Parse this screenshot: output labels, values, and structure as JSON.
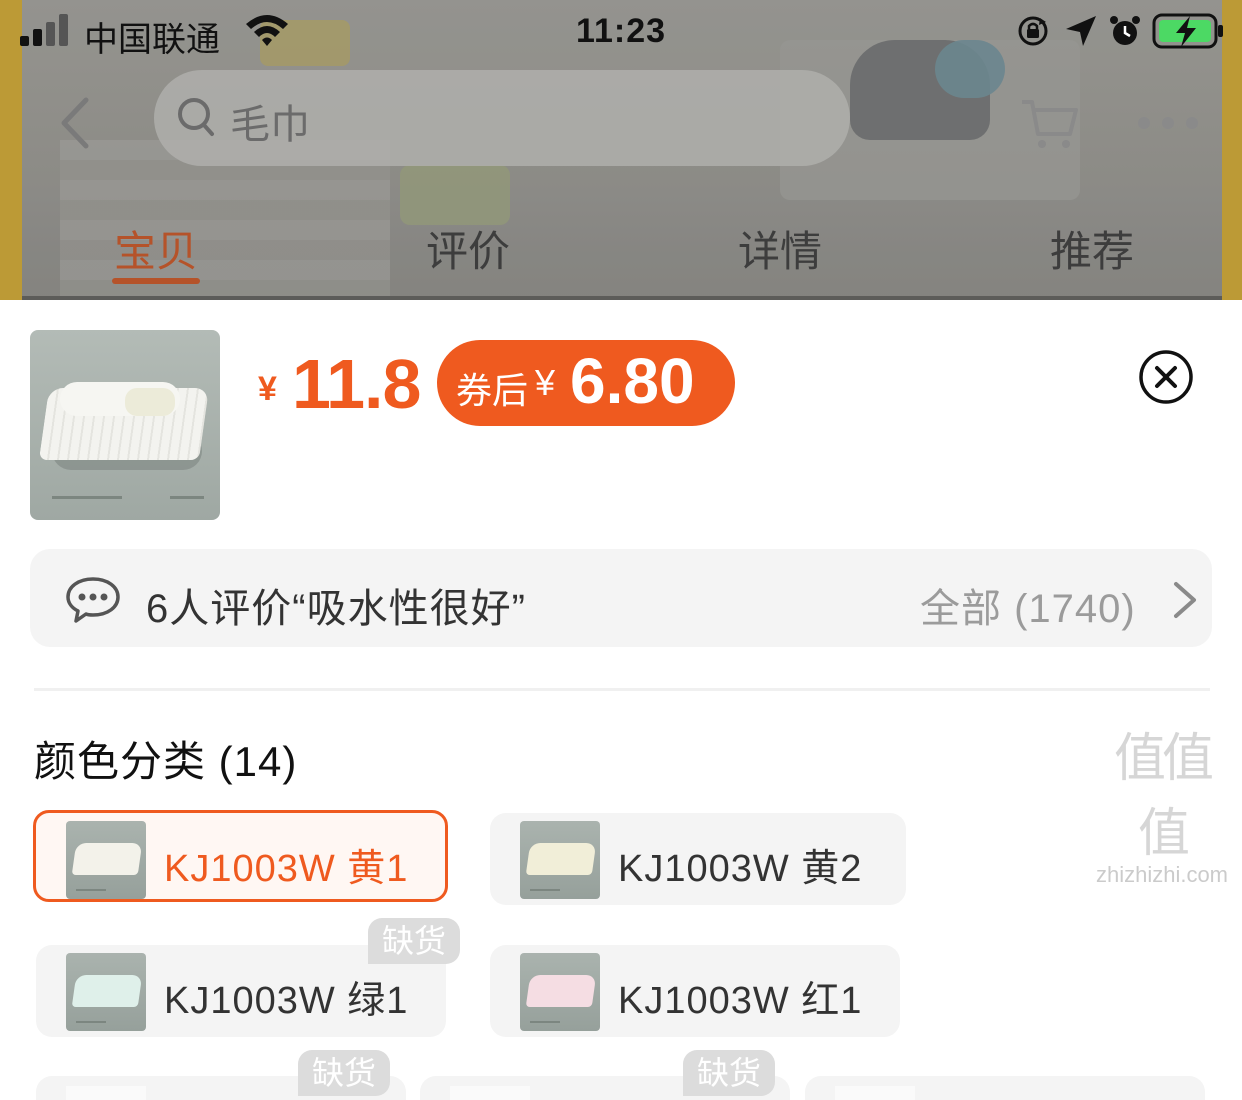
{
  "status_bar": {
    "carrier": "中国联通",
    "time": "11:23",
    "icons": [
      "signal-icon",
      "wifi-icon",
      "rotation-lock-icon",
      "location-icon",
      "alarm-icon",
      "battery-charging-icon"
    ]
  },
  "nav": {
    "search_placeholder": "毛巾",
    "icons": [
      "back-icon",
      "search-icon",
      "cart-icon",
      "more-icon"
    ]
  },
  "tabs": [
    {
      "label": "宝贝",
      "active": true
    },
    {
      "label": "评价",
      "active": false
    },
    {
      "label": "详情",
      "active": false
    },
    {
      "label": "推荐",
      "active": false
    }
  ],
  "sheet": {
    "price": {
      "currency": "¥",
      "value": "11.8",
      "coupon_label": "券后",
      "coupon_currency": "¥",
      "coupon_value": "6.80"
    },
    "review": {
      "summary": "6人评价“吸水性很好”",
      "all_label": "全部 (1740)"
    },
    "variants": {
      "title": "颜色分类 (14)",
      "sold_out_label": "缺货",
      "items": [
        {
          "label": "KJ1003W 黄1",
          "selected": true,
          "tint": "#f3f2ea"
        },
        {
          "label": "KJ1003W 黄2",
          "selected": false,
          "tint": "#f1eed8"
        },
        {
          "label": "KJ1003W 绿1",
          "selected": false,
          "tint": "#dff0ea"
        },
        {
          "label": "KJ1003W 红1",
          "selected": false,
          "tint": "#f5dde3"
        }
      ]
    }
  },
  "watermark": {
    "logo": "值值值",
    "site": "zhizhizhi.com"
  },
  "colors": {
    "accent": "#ef5a1f",
    "tab_active": "#b5532a",
    "sold_out_badge": "#dcdcdc"
  }
}
